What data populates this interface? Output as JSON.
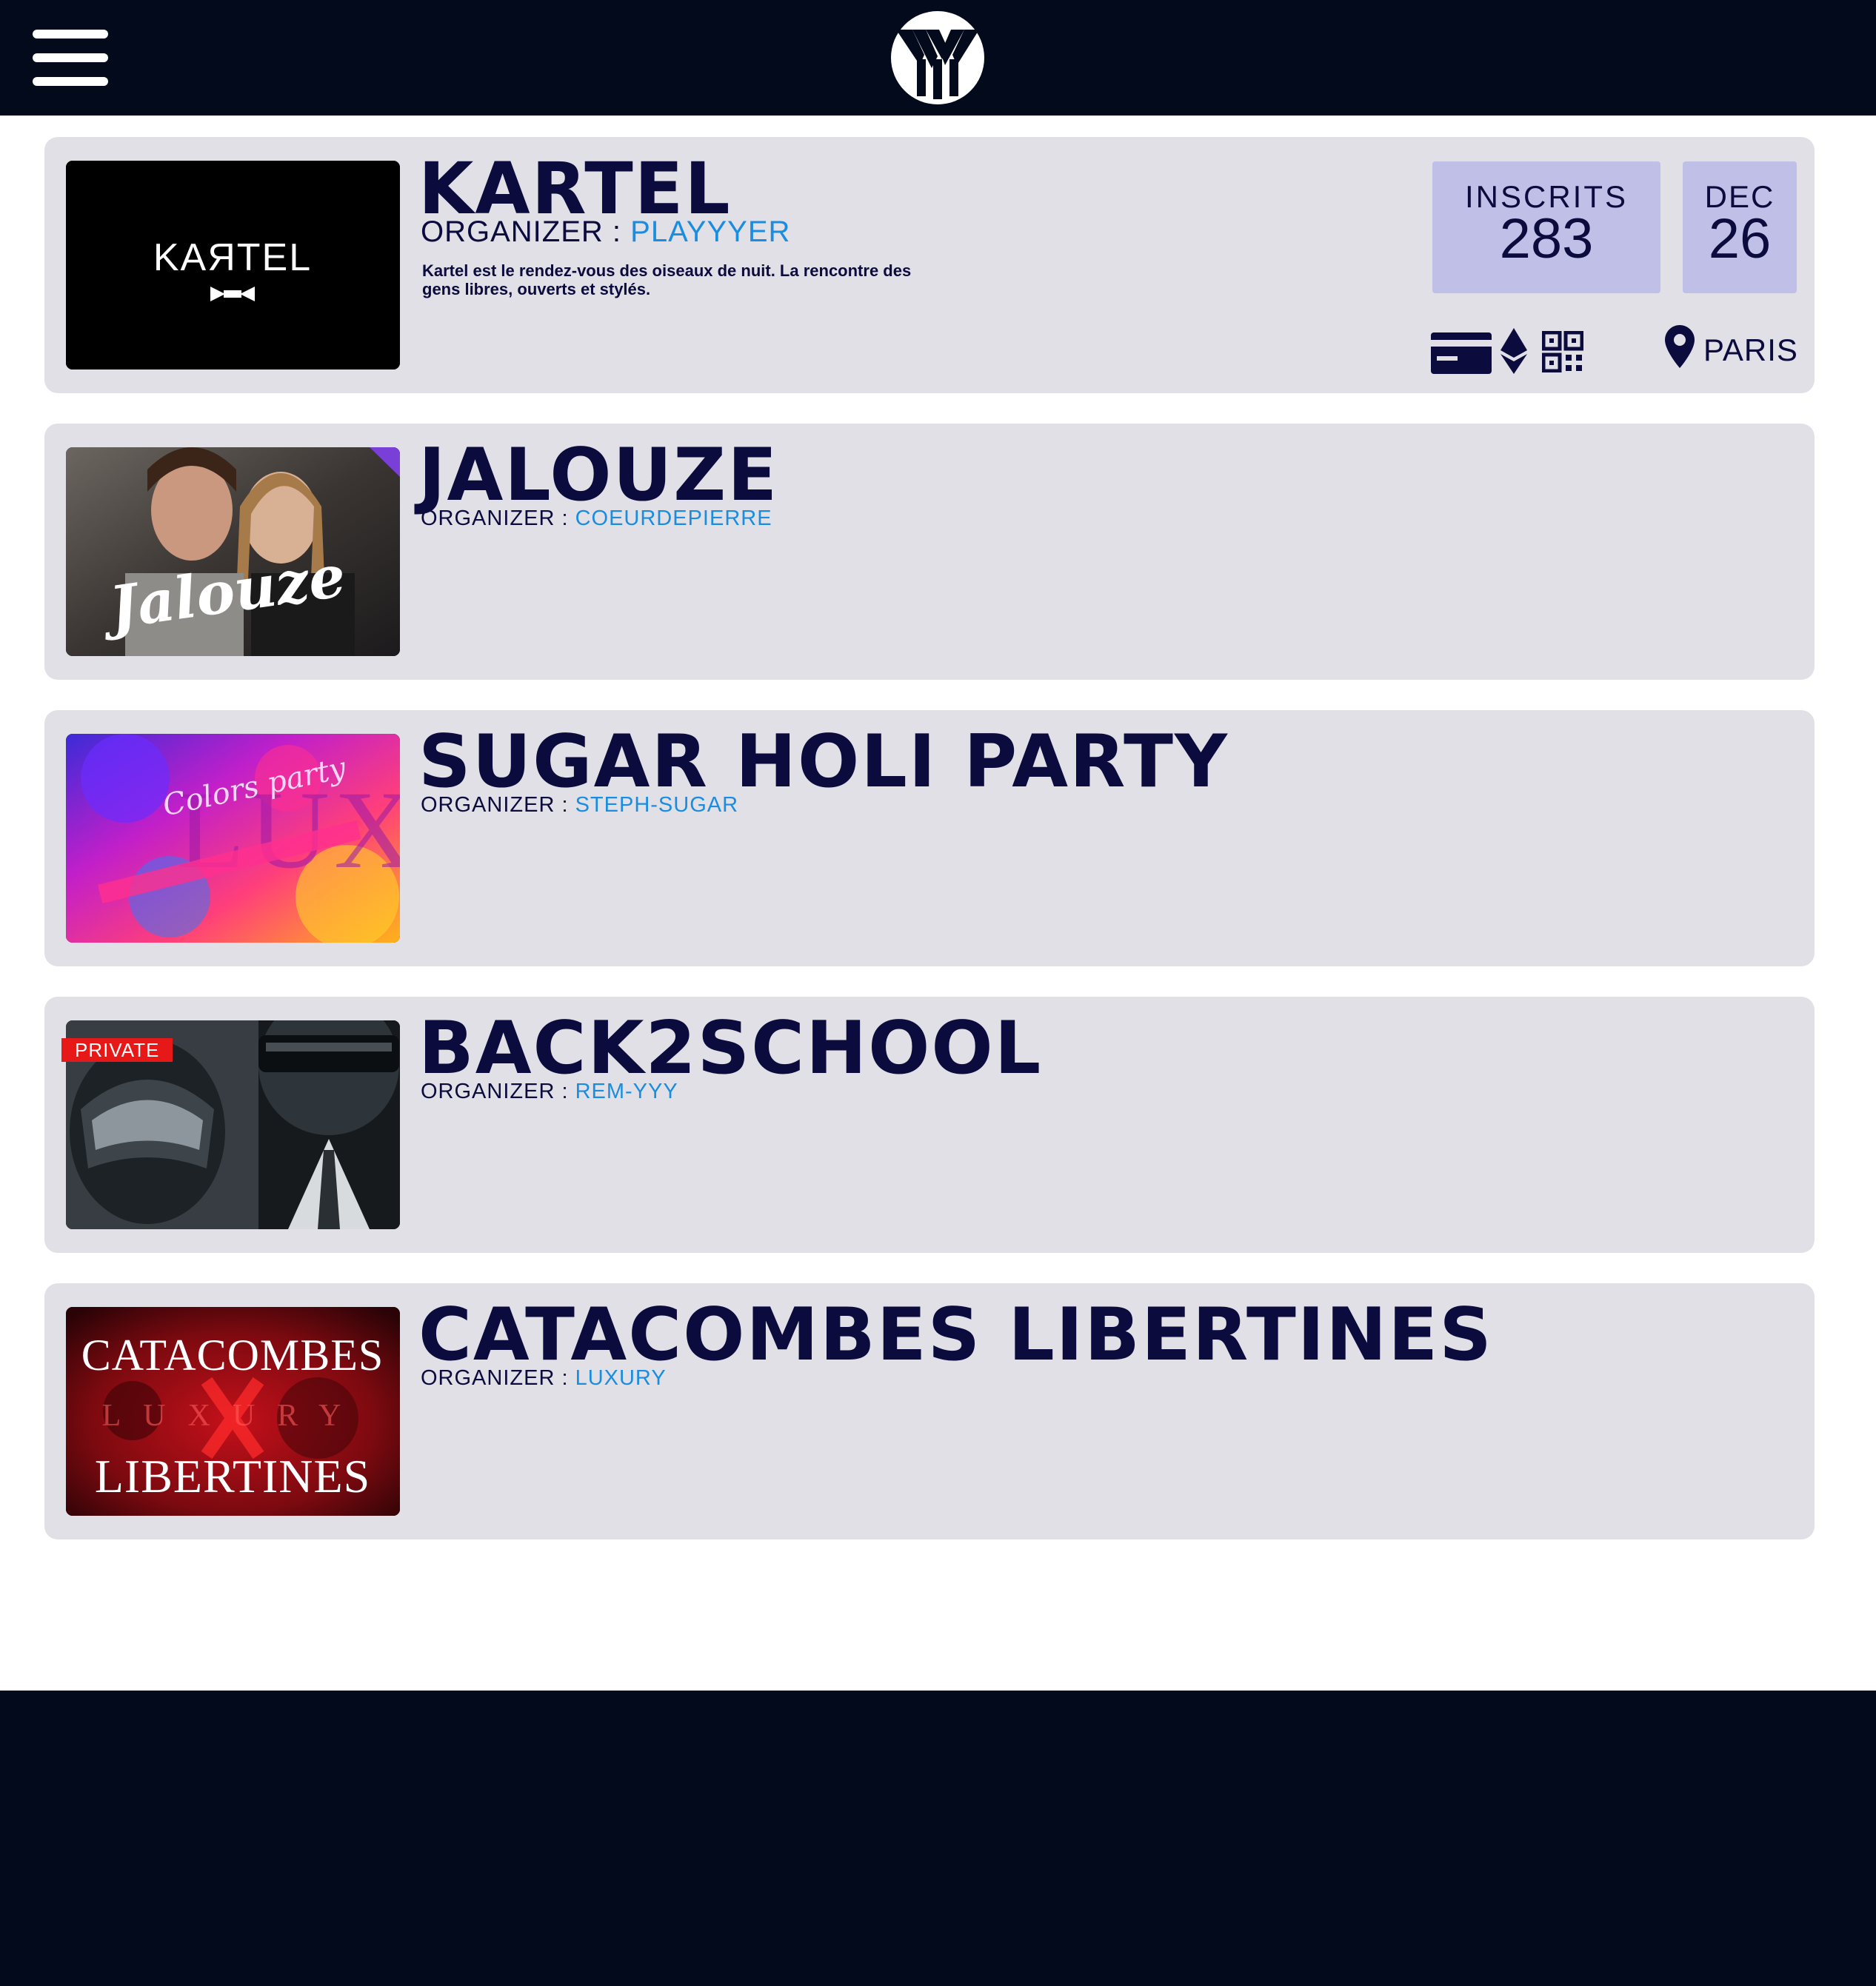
{
  "header": {
    "menu_icon": "hamburger-menu-icon",
    "logo_icon": "yyy-logo-icon"
  },
  "events": [
    {
      "title": "KARTEL",
      "organizer_label": "ORGANIZER :",
      "organizer": "PLAYYYER",
      "description": "Kartel est le rendez-vous des oiseaux de nuit. La rencontre des gens libres, ouverts et stylés.",
      "image_text": "KAЯTEL",
      "inscrits_label": "INSCRITS",
      "inscrits_value": "283",
      "month": "DEC",
      "day": "26",
      "payment_icons": [
        "credit-card-icon",
        "ethereum-icon",
        "qr-code-icon"
      ],
      "location": "PARIS"
    },
    {
      "title": "JALOUZE",
      "organizer_label": "ORGANIZER :",
      "organizer": "COEURDEPIERRE",
      "image_text": "Jalouze"
    },
    {
      "title": "SUGAR HOLI PARTY",
      "organizer_label": "ORGANIZER :",
      "organizer": "STEPH-SUGAR",
      "image_text": "Colors party"
    },
    {
      "title": "BACK2SCHOOL",
      "organizer_label": "ORGANIZER :",
      "organizer": "REM-YYY",
      "private_label": "PRIVATE"
    },
    {
      "title": "CATACOMBES LIBERTINES",
      "organizer_label": "ORGANIZER :",
      "organizer": "LUXURY",
      "image_text_top": "CATACOMBES",
      "image_text_mid": "LUXURY",
      "image_text_bottom": "LIBERTINES"
    }
  ],
  "colors": {
    "navy": "#020a1c",
    "card": "#e0e0e6",
    "accent": "#1a8de0",
    "badge": "#bfbfe8",
    "private": "#e61818"
  }
}
